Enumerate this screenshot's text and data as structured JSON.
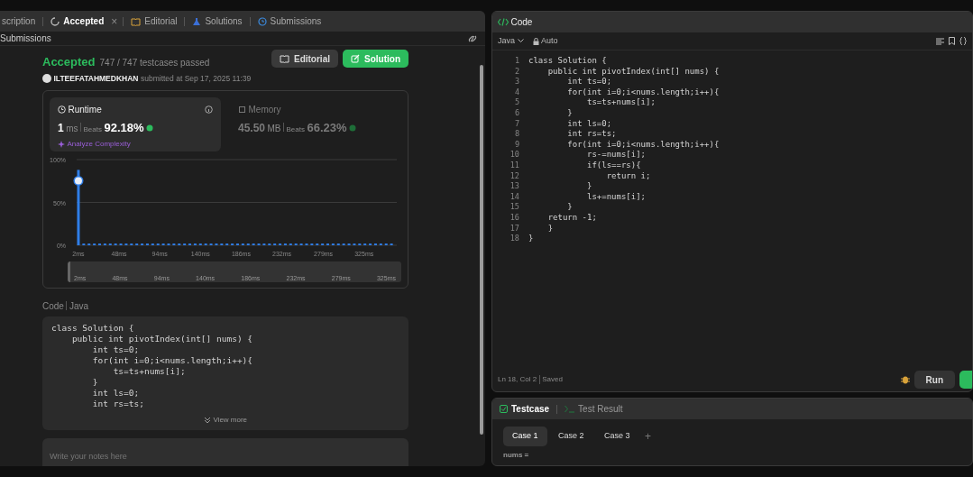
{
  "left_tabs": [
    {
      "label": "scription",
      "kind": "plain",
      "selected": false,
      "closable": false
    },
    {
      "label": "Accepted",
      "kind": "spinner",
      "selected": true,
      "closable": true
    },
    {
      "label": "Editorial",
      "kind": "book",
      "selected": false,
      "closable": false
    },
    {
      "label": "Solutions",
      "kind": "flask",
      "selected": false,
      "closable": false
    },
    {
      "label": "Submissions",
      "kind": "history",
      "selected": false,
      "closable": false
    }
  ],
  "close_glyph": "×",
  "section_title": "Submissions",
  "result": {
    "status": "Accepted",
    "testcases": "747 / 747 testcases passed",
    "user": "ILTEEFATAHMEDKHAN",
    "submitted": "submitted at Sep 17, 2025 11:39"
  },
  "actions": [
    {
      "label": "Editorial",
      "kind": "secondary"
    },
    {
      "label": "Solution",
      "kind": "success"
    }
  ],
  "stats": [
    {
      "title": "Runtime",
      "value": "1",
      "unit": "ms",
      "beats_label": "Beats",
      "beats": "92.18%",
      "selected": true,
      "link": "Analyze Complexity"
    },
    {
      "title": "Memory",
      "value": "45.50",
      "unit": "MB",
      "beats_label": "Beats",
      "beats": "66.23%",
      "selected": false
    }
  ],
  "chart_data": {
    "type": "bar",
    "x": [
      2,
      8,
      14,
      20,
      26,
      32,
      38,
      44,
      50,
      56,
      62,
      68,
      74,
      80,
      86,
      92,
      98,
      104,
      110,
      116,
      122,
      128,
      134,
      140,
      146,
      152,
      158,
      164,
      170,
      176,
      182,
      188,
      194,
      200,
      206,
      212,
      218,
      224,
      230,
      236,
      242,
      248,
      254,
      260,
      266,
      272,
      278,
      284,
      290,
      296,
      302,
      308,
      314,
      320,
      326,
      332,
      338,
      344,
      350,
      356
    ],
    "values": [
      88,
      2,
      2,
      2,
      2,
      2,
      2,
      2,
      2,
      2,
      2,
      2,
      2,
      2,
      2,
      2,
      2,
      2,
      2,
      2,
      2,
      2,
      2,
      2,
      2,
      2,
      2,
      2,
      2,
      2,
      2,
      2,
      2,
      2,
      2,
      2,
      2,
      2,
      2,
      2,
      2,
      2,
      2,
      2,
      2,
      2,
      2,
      2,
      2,
      2,
      2,
      2,
      2,
      2,
      2,
      2,
      2,
      2,
      2,
      2
    ],
    "xlim": [
      0,
      362
    ],
    "ylim": [
      0,
      100
    ],
    "xticks": [
      {
        "value": 2,
        "label": "2ms"
      },
      {
        "value": 48,
        "label": "48ms"
      },
      {
        "value": 94,
        "label": "94ms"
      },
      {
        "value": 140,
        "label": "140ms"
      },
      {
        "value": 186,
        "label": "186ms"
      },
      {
        "value": 232,
        "label": "232ms"
      },
      {
        "value": 279,
        "label": "279ms"
      },
      {
        "value": 325,
        "label": "325ms"
      }
    ],
    "yticks": [
      {
        "value": 0,
        "label": "0%"
      },
      {
        "value": 50,
        "label": "50%"
      },
      {
        "value": 100,
        "label": "100%"
      }
    ]
  },
  "navigator_ticks": [
    "2ms",
    "48ms",
    "94ms",
    "140ms",
    "186ms",
    "232ms",
    "279ms",
    "325ms"
  ],
  "code_heading": {
    "title": "Code",
    "language": "Java"
  },
  "code_preview": [
    "class Solution {",
    "    public int pivotIndex(int[] nums) {",
    "        int ts=0;",
    "        for(int i=0;i<nums.length;i++){",
    "            ts=ts+nums[i];",
    "        }",
    "        int ls=0;",
    "        int rs=ts;"
  ],
  "view_more": "View more",
  "notes": {
    "placeholder": "Write your notes here"
  },
  "editor": {
    "title": "Code",
    "language": "Java",
    "mode": "Auto",
    "lines": [
      "class Solution {",
      "    public int pivotIndex(int[] nums) {",
      "        int ts=0;",
      "        for(int i=0;i<nums.length;i++){",
      "            ts=ts+nums[i];",
      "        }",
      "        int ls=0;",
      "        int rs=ts;",
      "        for(int i=0;i<nums.length;i++){",
      "            rs-=nums[i];",
      "            if(ls==rs){",
      "                return i;",
      "            }",
      "            ls+=nums[i];",
      "        }",
      "    return -1;",
      "    }",
      "}"
    ],
    "line_numbers": [
      "1",
      "2",
      "3",
      "4",
      "5",
      "6",
      "7",
      "8",
      "9",
      "10",
      "11",
      "12",
      "13",
      "14",
      "15",
      "16",
      "17",
      "18"
    ],
    "position": "Ln 18, Col 2",
    "save_state": "Saved",
    "run": "Run"
  },
  "bottom_tabs": [
    {
      "label": "Testcase",
      "selected": true
    },
    {
      "label": "Test Result",
      "selected": false
    }
  ],
  "cases": [
    {
      "label": "Case 1",
      "selected": true
    },
    {
      "label": "Case 2",
      "selected": false
    },
    {
      "label": "Case 3",
      "selected": false
    }
  ],
  "add_glyph": "+",
  "input_label": "nums ="
}
